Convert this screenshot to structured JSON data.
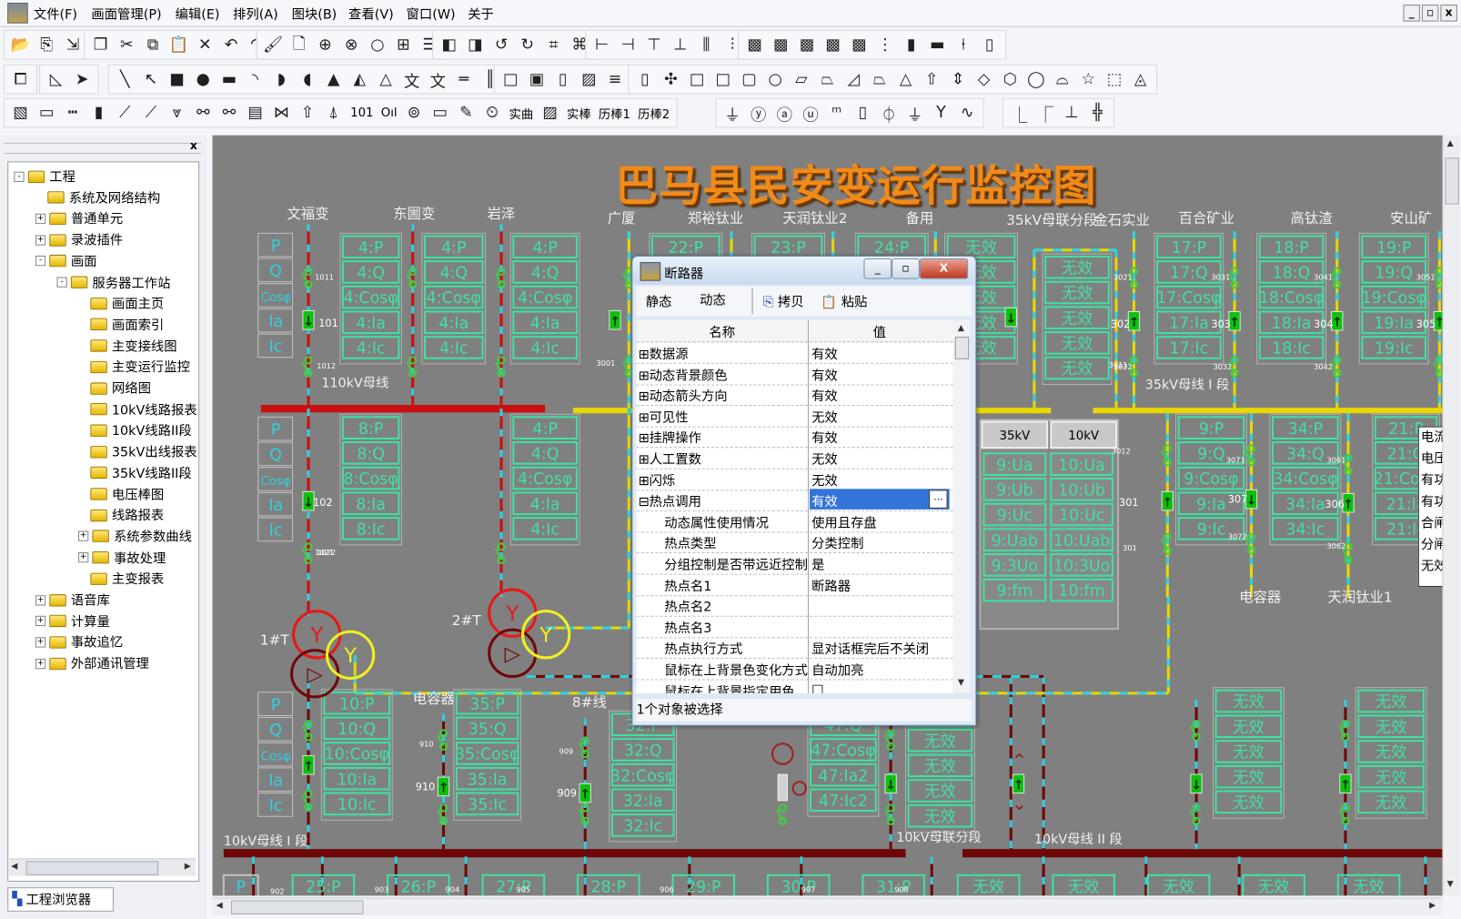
{
  "menubar": {
    "items": [
      "文件(F)",
      "画面管理(P)",
      "编辑(E)",
      "排列(A)",
      "图块(B)",
      "查看(V)",
      "窗口(W)",
      "关于"
    ],
    "window_controls": [
      "_",
      "▫",
      "x"
    ]
  },
  "toolbars": [
    [
      [
        {
          "icon": "open-folder-icon",
          "glyph": "📂"
        },
        {
          "icon": "import-icon",
          "glyph": "⎘"
        },
        {
          "icon": "export-icon",
          "glyph": "⇲"
        }
      ],
      [
        {
          "icon": "copy-icon",
          "glyph": "❐"
        },
        {
          "icon": "cut-icon",
          "glyph": "✂"
        },
        {
          "icon": "duplicate-icon",
          "glyph": "⧉"
        },
        {
          "icon": "paste-icon",
          "glyph": "📋"
        },
        {
          "icon": "delete-icon",
          "glyph": "✕"
        },
        {
          "icon": "undo-icon",
          "glyph": "↶"
        },
        {
          "icon": "redo-icon",
          "glyph": "↷"
        }
      ],
      [
        {
          "icon": "format-brush-icon",
          "glyph": "🖌"
        },
        {
          "icon": "print-preview-icon",
          "glyph": "🗋"
        },
        {
          "icon": "zoom-in-icon",
          "glyph": "⊕"
        },
        {
          "icon": "zoom-cancel-icon",
          "glyph": "⊗"
        },
        {
          "icon": "zoom-icon",
          "glyph": "○"
        },
        {
          "icon": "zoom-fit-icon",
          "glyph": "⊞"
        },
        {
          "icon": "grid-icon",
          "glyph": "☰"
        }
      ],
      [
        {
          "icon": "bring-front-icon",
          "glyph": "◧"
        },
        {
          "icon": "send-back-icon",
          "glyph": "◨"
        },
        {
          "icon": "rotate-left-icon",
          "glyph": "↺"
        },
        {
          "icon": "rotate-right-icon",
          "glyph": "↻"
        },
        {
          "icon": "group-icon",
          "glyph": "⌗"
        },
        {
          "icon": "ungroup-icon",
          "glyph": "⌘"
        }
      ],
      [
        {
          "icon": "align-left-icon",
          "glyph": "⊢"
        },
        {
          "icon": "align-right-icon",
          "glyph": "⊣"
        },
        {
          "icon": "align-top-icon",
          "glyph": "⊤"
        },
        {
          "icon": "align-bottom-icon",
          "glyph": "⊥"
        },
        {
          "icon": "space-horizontal-icon",
          "glyph": "⫼"
        },
        {
          "icon": "space-vertical-icon",
          "glyph": "⫶"
        }
      ],
      [
        {
          "icon": "display-1-icon",
          "glyph": "▩"
        },
        {
          "icon": "display-2-icon",
          "glyph": "▩"
        },
        {
          "icon": "display-3-icon",
          "glyph": "▩"
        },
        {
          "icon": "display-4-icon",
          "glyph": "▩"
        },
        {
          "icon": "display-5-icon",
          "glyph": "▩"
        },
        {
          "icon": "scale-icon",
          "glyph": "⋮"
        },
        {
          "icon": "meter-icon",
          "glyph": "▮"
        },
        {
          "icon": "bar-icon",
          "glyph": "▬"
        },
        {
          "icon": "level-icon",
          "glyph": "⍿"
        },
        {
          "icon": "battery-icon",
          "glyph": "▯"
        }
      ]
    ],
    [
      [
        {
          "icon": "window-icon",
          "glyph": "⧠"
        }
      ],
      [
        {
          "icon": "angle-icon",
          "glyph": "◺"
        },
        {
          "icon": "pointer-icon",
          "glyph": "➤"
        }
      ],
      [
        {
          "icon": "line-icon",
          "glyph": "╲"
        },
        {
          "icon": "arrow-line-icon",
          "glyph": "↖"
        },
        {
          "icon": "rectangle-icon",
          "glyph": "■"
        },
        {
          "icon": "ellipse-icon",
          "glyph": "●"
        },
        {
          "icon": "rounded-rect-icon",
          "glyph": "▬"
        },
        {
          "icon": "arc-icon",
          "glyph": "◝"
        },
        {
          "icon": "chord-icon",
          "glyph": "◗"
        },
        {
          "icon": "pie-icon",
          "glyph": "◖"
        },
        {
          "icon": "polygon-icon",
          "glyph": "▲"
        },
        {
          "icon": "polyline-icon",
          "glyph": "◭"
        },
        {
          "icon": "freeform-icon",
          "glyph": "△"
        },
        {
          "icon": "text-icon",
          "glyph": "文"
        },
        {
          "icon": "text-box-icon",
          "glyph": "文"
        },
        {
          "icon": "hline-icon",
          "glyph": "═"
        },
        {
          "icon": "vline-icon",
          "glyph": "║"
        }
      ],
      [
        {
          "icon": "frame-icon",
          "glyph": "□"
        },
        {
          "icon": "button-icon",
          "glyph": "▣"
        },
        {
          "icon": "panel-icon",
          "glyph": "▯"
        },
        {
          "icon": "image-icon",
          "glyph": "▨"
        },
        {
          "icon": "list-icon",
          "glyph": "≡"
        }
      ],
      [
        {
          "icon": "cylinder-icon",
          "glyph": "▯"
        },
        {
          "icon": "fan-icon",
          "glyph": "✣"
        },
        {
          "icon": "rect-3d-icon",
          "glyph": "□"
        },
        {
          "icon": "rect-shade-icon",
          "glyph": "□"
        },
        {
          "icon": "rounded-box-icon",
          "glyph": "▢"
        },
        {
          "icon": "circle-icon",
          "glyph": "○"
        },
        {
          "icon": "parallelogram-icon",
          "glyph": "▱"
        },
        {
          "icon": "trapezoid-icon",
          "glyph": "⏢"
        },
        {
          "icon": "right-trapezoid-icon",
          "glyph": "◿"
        },
        {
          "icon": "trapezoid-2-icon",
          "glyph": "⏢"
        },
        {
          "icon": "triangle-icon",
          "glyph": "△"
        },
        {
          "icon": "arrow-up-icon",
          "glyph": "⇧"
        },
        {
          "icon": "arrow-updown-icon",
          "glyph": "⇕"
        },
        {
          "icon": "diamond-icon",
          "glyph": "◇"
        },
        {
          "icon": "hexagon-icon",
          "glyph": "⬡"
        },
        {
          "icon": "octagon-icon",
          "glyph": "◯"
        },
        {
          "icon": "dome-icon",
          "glyph": "⌓"
        },
        {
          "icon": "star-icon",
          "glyph": "☆"
        },
        {
          "icon": "cube-icon",
          "glyph": "⬚"
        },
        {
          "icon": "pyramid-icon",
          "glyph": "◬"
        }
      ]
    ],
    [
      [
        {
          "icon": "picture-icon",
          "glyph": "▧"
        },
        {
          "icon": "bus-icon",
          "glyph": "▭"
        },
        {
          "icon": "dash-line-icon",
          "glyph": "┅"
        },
        {
          "icon": "fuse-icon",
          "glyph": "▮"
        },
        {
          "icon": "switch-icon",
          "glyph": "⟋"
        },
        {
          "icon": "disconnector-icon",
          "glyph": "⟋"
        },
        {
          "icon": "double-arrow-icon",
          "glyph": "⩔"
        },
        {
          "icon": "link-icon",
          "glyph": "⚯"
        },
        {
          "icon": "link-2-icon",
          "glyph": "⚯"
        },
        {
          "icon": "counter-icon",
          "glyph": "▤"
        },
        {
          "icon": "breaker-icon",
          "glyph": "⋈"
        },
        {
          "icon": "arrow-icon",
          "glyph": "⇧"
        },
        {
          "icon": "arrow-2-icon",
          "glyph": "⍋"
        },
        {
          "text": "101",
          "icon": "digital-text"
        },
        {
          "text": "Oıl",
          "icon": "analog-text"
        },
        {
          "icon": "ac-source-icon",
          "glyph": "⊚"
        },
        {
          "icon": "window-2-icon",
          "glyph": "▭"
        },
        {
          "icon": "pen-icon",
          "glyph": "✎"
        },
        {
          "icon": "clock-icon",
          "glyph": "⏲"
        },
        {
          "text": "实曲",
          "icon": "realtime-curve"
        },
        {
          "icon": "chart-icon",
          "glyph": "▨"
        },
        {
          "text": "实棒",
          "icon": "realtime-bar"
        },
        {
          "text": "历棒1",
          "icon": "history-bar-1"
        },
        {
          "text": "历棒2",
          "icon": "history-bar-2"
        }
      ],
      [
        {
          "icon": "capacitor-icon",
          "glyph": "⏚"
        },
        {
          "icon": "transformer-y-icon",
          "glyph": "ⓨ"
        },
        {
          "icon": "transformer-d-icon",
          "glyph": "ⓐ"
        },
        {
          "icon": "transformer-u-icon",
          "glyph": "ⓤ"
        },
        {
          "icon": "reactor-icon",
          "glyph": "ᵐ"
        },
        {
          "icon": "resistor-icon",
          "glyph": "▯"
        },
        {
          "icon": "fuse-2-icon",
          "glyph": "⏀"
        },
        {
          "icon": "ground-icon",
          "glyph": "⏚"
        },
        {
          "icon": "y-icon",
          "glyph": "Y"
        },
        {
          "icon": "wave-icon",
          "glyph": "∿"
        }
      ],
      [
        {
          "icon": "connector-1-icon",
          "glyph": "⎿"
        },
        {
          "icon": "connector-2-icon",
          "glyph": "⎾"
        },
        {
          "icon": "connector-3-icon",
          "glyph": "⊥"
        },
        {
          "icon": "connector-4-icon",
          "glyph": "╬"
        }
      ]
    ]
  ],
  "left_panel": {
    "close": "x",
    "tree": [
      {
        "label": "工程",
        "level": 0,
        "exp": "-"
      },
      {
        "label": "系统及网络结构",
        "level": 1,
        "exp": ""
      },
      {
        "label": "普通单元",
        "level": 1,
        "exp": "+"
      },
      {
        "label": "录波插件",
        "level": 1,
        "exp": "+"
      },
      {
        "label": "画面",
        "level": 1,
        "exp": "-"
      },
      {
        "label": "服务器工作站",
        "level": 2,
        "exp": "-"
      },
      {
        "label": "画面主页",
        "level": 3,
        "exp": ""
      },
      {
        "label": "画面索引",
        "level": 3,
        "exp": ""
      },
      {
        "label": "主变接线图",
        "level": 3,
        "exp": ""
      },
      {
        "label": "主变运行监控",
        "level": 3,
        "exp": ""
      },
      {
        "label": "网络图",
        "level": 3,
        "exp": ""
      },
      {
        "label": "10kV线路报表",
        "level": 3,
        "exp": ""
      },
      {
        "label": "10kV线路II段",
        "level": 3,
        "exp": ""
      },
      {
        "label": "35kV出线报表",
        "level": 3,
        "exp": ""
      },
      {
        "label": "35kV线路II段",
        "level": 3,
        "exp": ""
      },
      {
        "label": "电压棒图",
        "level": 3,
        "exp": ""
      },
      {
        "label": "线路报表",
        "level": 3,
        "exp": ""
      },
      {
        "label": "系统参数曲线",
        "level": 3,
        "exp": "+"
      },
      {
        "label": "事故处理",
        "level": 3,
        "exp": "+"
      },
      {
        "label": "主变报表",
        "level": 3,
        "exp": ""
      },
      {
        "label": "语音库",
        "level": 1,
        "exp": "+"
      },
      {
        "label": "计算量",
        "level": 1,
        "exp": "+"
      },
      {
        "label": "事故追忆",
        "level": 1,
        "exp": "+"
      },
      {
        "label": "外部通讯管理",
        "level": 1,
        "exp": "+"
      }
    ],
    "tab_label": "工程浏览器"
  },
  "diagram": {
    "title": "巴马县民安变运行监控图",
    "colors": {
      "bus_110kv": "#c81010",
      "bus_35kv": "#e8d800",
      "bus_10kv": "#6e0808",
      "measure": "#40e0a0",
      "cyan": "#30d0e0",
      "breaker": "#10c010"
    },
    "station_labels": [
      "文福变",
      "东圌变",
      "岩泽",
      "广厦",
      "郑裕钛业",
      "天润钛业2",
      "备用",
      "35kV母联分段",
      "金石实业",
      "百合矿业",
      "高钛渣",
      "安山矿"
    ],
    "bus_labels": [
      "110kV母线",
      "35kV母线 I 段",
      "10kV母线 I 段",
      "10kV母联分段",
      "10kV母线 II 段"
    ],
    "other_labels": [
      "1#T",
      "2#T",
      "电容器",
      "8#线",
      "电容器",
      "天润钛业1"
    ],
    "param_labels": [
      "P",
      "Q",
      "Cosφ",
      "Ia",
      "Ic"
    ],
    "measure_groups": [
      [
        "4:P",
        "4:Q",
        "4:Cosφ",
        "4:Ia",
        "4:Ic"
      ],
      [
        "4:P",
        "4:Q",
        "4:Cosφ",
        "4:Ia",
        "4:Ic"
      ],
      [
        "4:P",
        "4:Q",
        "4:Cosφ",
        "4:Ia",
        "4:Ic"
      ],
      [
        "22:P",
        "22:Q",
        "22:Cosφ",
        "22:Ia",
        "22:Ic"
      ],
      [
        "23:P",
        "23:Q",
        "23:Cosφ",
        "23:Ia",
        "23:Ic"
      ],
      [
        "24:P",
        "24:Q",
        "24:Cosφ",
        "24:Ia",
        "24:Ic"
      ],
      [
        "无效",
        "无效",
        "无效",
        "无效",
        "无效"
      ],
      [
        "无效",
        "无效",
        "无效",
        "无效",
        "无效"
      ],
      [
        "17:P",
        "17:Q",
        "17:Cosφ",
        "17:Ia",
        "17:Ic"
      ],
      [
        "18:P",
        "18:Q",
        "18:Cosφ",
        "18:Ia",
        "18:Ic"
      ],
      [
        "19:P",
        "19:Q",
        "19:Cosφ",
        "19:Ia",
        "19:Ic"
      ],
      [
        "8:P",
        "8:Q",
        "8:Cosφ",
        "8:Ia",
        "8:Ic"
      ],
      [
        "4:P",
        "4:Q",
        "4:Cosφ",
        "4:Ia",
        "4:Ic"
      ],
      [
        "9:P",
        "9:Q",
        "9:Cosφ",
        "9:Ia",
        "9:Ic"
      ],
      [
        "34:P",
        "34:Q",
        "34:Cosφ",
        "34:Ia",
        "34:Ic"
      ],
      [
        "21:P",
        "21:Q",
        "21:Cosφ",
        "21:Ia",
        "21:Ic"
      ],
      [
        "10:P",
        "10:Q",
        "10:Cosφ",
        "10:Ia",
        "10:Ic"
      ],
      [
        "35:P",
        "35:Q",
        "35:Cosφ",
        "35:Ia",
        "35:Ic"
      ],
      [
        "32:P",
        "32:Q",
        "32:Cosφ",
        "32:Ia",
        "32:Ic"
      ],
      [
        "47:Q",
        "47:Cosφ",
        "47:Ia2",
        "47:Ic2"
      ],
      [
        "无效",
        "无效",
        "无效",
        "无效",
        "无效"
      ],
      [
        "无效",
        "无效",
        "无效",
        "无效",
        "无效"
      ],
      [
        "无效",
        "无效",
        "无效",
        "无效",
        "无效"
      ]
    ],
    "bottom_row": [
      "P",
      "25:P",
      "26:P",
      "27:P",
      "28:P",
      "29:P",
      "30:P",
      "31:P",
      "无效",
      "无效",
      "无效",
      "无效",
      "无效"
    ],
    "voltage_buttons": [
      "35kV",
      "10kV"
    ],
    "voltage_table": [
      [
        "9:Ua",
        "10:Ua"
      ],
      [
        "9:Ub",
        "10:Ub"
      ],
      [
        "9:Uc",
        "10:Uc"
      ],
      [
        "9:Uab",
        "10:Uab"
      ],
      [
        "9:3Uo",
        "10:3Uo"
      ],
      [
        "9:fm",
        "10:fm"
      ]
    ],
    "breaker_ids": [
      "101",
      "102",
      "302",
      "303",
      "304",
      "305",
      "301",
      "307",
      "306",
      "910",
      "909"
    ],
    "switch_ids": [
      "1011",
      "1012",
      "1021",
      "1022",
      "3021",
      "3022",
      "3031",
      "3032",
      "3041",
      "3042",
      "3051",
      "3001",
      "3011",
      "3012",
      "3071",
      "3072",
      "3061",
      "3062",
      "301",
      "910",
      "909",
      "902",
      "903",
      "904",
      "905",
      "906",
      "907",
      "908"
    ],
    "side_panel_lines": [
      "电流",
      "电压",
      "有功",
      "有功",
      "合闸",
      "分闸",
      "无效"
    ]
  },
  "dialog": {
    "title": "断路器",
    "window_controls": [
      "_",
      "▫",
      "X"
    ],
    "tabs": [
      "静态",
      "动态"
    ],
    "copy_label": "拷贝",
    "paste_label": "粘贴",
    "columns": [
      "名称",
      "值"
    ],
    "rows": [
      {
        "name": "数据源",
        "value": "有效",
        "exp": "⊞"
      },
      {
        "name": "动态背景颜色",
        "value": "有效",
        "exp": "⊞"
      },
      {
        "name": "动态箭头方向",
        "value": "有效",
        "exp": "⊞"
      },
      {
        "name": "可见性",
        "value": "无效",
        "exp": "⊞"
      },
      {
        "name": "挂牌操作",
        "value": "有效",
        "exp": "⊞"
      },
      {
        "name": "人工置数",
        "value": "无效",
        "exp": "⊞"
      },
      {
        "name": "闪烁",
        "value": "无效",
        "exp": "⊞"
      },
      {
        "name": "热点调用",
        "value": "有效",
        "exp": "⊟",
        "selected": true
      },
      {
        "name": "动态属性使用情况",
        "value": "使用且存盘",
        "exp": ""
      },
      {
        "name": "热点类型",
        "value": "分类控制",
        "exp": ""
      },
      {
        "name": "分组控制是否带远近控制",
        "value": "是",
        "exp": ""
      },
      {
        "name": "热点名1",
        "value": "断路器",
        "exp": ""
      },
      {
        "name": "热点名2",
        "value": "",
        "exp": ""
      },
      {
        "name": "热点名3",
        "value": "",
        "exp": ""
      },
      {
        "name": "热点执行方式",
        "value": "显对话框完后不关闭",
        "exp": ""
      },
      {
        "name": "鼠标在上背景色变化方式",
        "value": "自动加亮",
        "exp": ""
      },
      {
        "name": "鼠标在上背景指定用色",
        "value": "□",
        "exp": ""
      }
    ],
    "status": "1个对象被选择"
  }
}
